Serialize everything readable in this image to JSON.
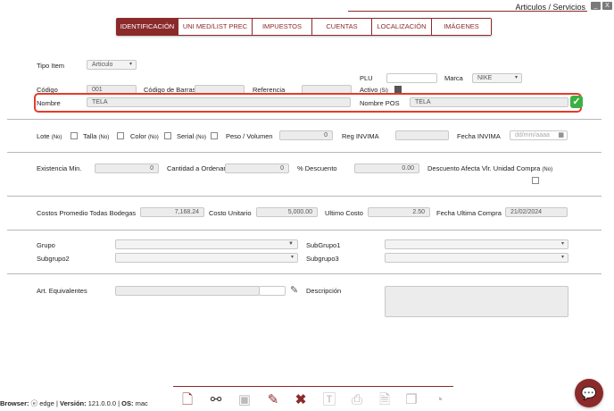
{
  "window": {
    "title": "Articulos / Servicios",
    "minimize_label": "_",
    "close_label": "X"
  },
  "tabs": [
    {
      "label": "IDENTIFICACIÓN",
      "active": true
    },
    {
      "label": "UNI MED/LIST PREC",
      "active": false
    },
    {
      "label": "IMPUESTOS",
      "active": false
    },
    {
      "label": "CUENTAS",
      "active": false
    },
    {
      "label": "LOCALIZACIÓN",
      "active": false
    },
    {
      "label": "IMÁGENES",
      "active": false
    }
  ],
  "ident": {
    "tipo_item_label": "Tipo Item",
    "tipo_item_value": "Articulo",
    "plu_label": "PLU",
    "plu_value": "",
    "marca_label": "Marca",
    "marca_value": "NIKE",
    "codigo_label": "Código",
    "codigo_value": "001",
    "codigo_barras_label": "Código de Barras",
    "codigo_barras_value": "",
    "referencia_label": "Referencia",
    "referencia_value": "",
    "activo_label": "Activo",
    "activo_hint": "(Si)",
    "nombre_label": "Nombre",
    "nombre_value": "TELA",
    "nombre_pos_label": "Nombre POS",
    "nombre_pos_value": "TELA",
    "valid_mark": "✓"
  },
  "flags": {
    "lote_label": "Lote",
    "lote_hint": "(No)",
    "talla_label": "Talla",
    "talla_hint": "(No)",
    "color_label": "Color",
    "color_hint": "(No)",
    "serial_label": "Serial",
    "serial_hint": "(No)",
    "peso_label": "Peso / Volumen",
    "peso_value": "0",
    "reg_invima_label": "Reg INVIMA",
    "reg_invima_value": "",
    "fecha_invima_label": "Fecha INVIMA",
    "fecha_invima_placeholder": "dd/mm/aaaa"
  },
  "stock": {
    "existencia_label": "Existencia Min.",
    "existencia_value": "0",
    "cantidad_label": "Cantidad a Ordenar",
    "cantidad_value": "0",
    "descuento_label": "% Descuento",
    "descuento_value": "0.00",
    "desc_afecta_label": "Descuento Afecta Vlr. Unidad Compra",
    "desc_afecta_hint": "(No)"
  },
  "costs": {
    "promedio_label": "Costos Promedio Todas Bodegas",
    "promedio_value": "7,168.24",
    "unitario_label": "Costo Unitario",
    "unitario_value": "5,000.00",
    "ultimo_label": "Ultimo Costo",
    "ultimo_value": "2.50",
    "fecha_label": "Fecha Ultima Compra",
    "fecha_value": "21/02/2024"
  },
  "groups": {
    "grupo_label": "Grupo",
    "subgrupo1_label": "SubGrupo1",
    "subgrupo2_label": "Subgrupo2",
    "subgrupo3_label": "Subgrupo3"
  },
  "equiv": {
    "art_equiv_label": "Art. Equivalentes",
    "descripcion_label": "Descripción"
  },
  "status": {
    "browser_label": "Browser:",
    "browser_value": "edge",
    "version_label": "Versión:",
    "version_value": "121.0.0.0",
    "os_label": "OS:",
    "os_value": "mac",
    "sep": "|"
  },
  "colors": {
    "brand": "#8b2a2a",
    "highlight": "#e53b2c",
    "ok": "#3cb043"
  }
}
